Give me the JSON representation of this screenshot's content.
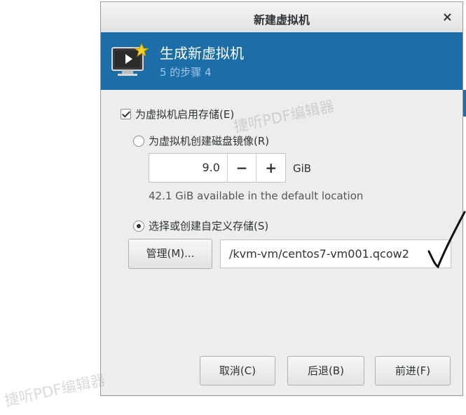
{
  "window": {
    "title": "新建虚拟机",
    "close_label": "×"
  },
  "header": {
    "title": "生成新虚拟机",
    "step": "5 的步骤 4"
  },
  "storage": {
    "enable_label": "为虚拟机启用存储(E)",
    "create_disk_label": "为虚拟机创建磁盘镜像(R)",
    "disk_size_value": "9.0",
    "minus_label": "−",
    "plus_label": "+",
    "unit": "GiB",
    "available_text": "42.1 GiB available in the default location",
    "custom_label": "选择或创建自定义存储(S)",
    "manage_label": "管理(M)...",
    "path_value": "/kvm-vm/centos7-vm001.qcow2"
  },
  "footer": {
    "cancel_label": "取消(C)",
    "back_label": "后退(B)",
    "forward_label": "前进(F)"
  },
  "watermarks": [
    "捷听PDF编辑器",
    "捷听PDF编辑器"
  ],
  "colors": {
    "accent": "#1c6ea8",
    "dialog_bg": "#ededed"
  },
  "icons": {
    "header_icon": "monitor-star-icon",
    "annotation": "handwritten-checkmark"
  }
}
